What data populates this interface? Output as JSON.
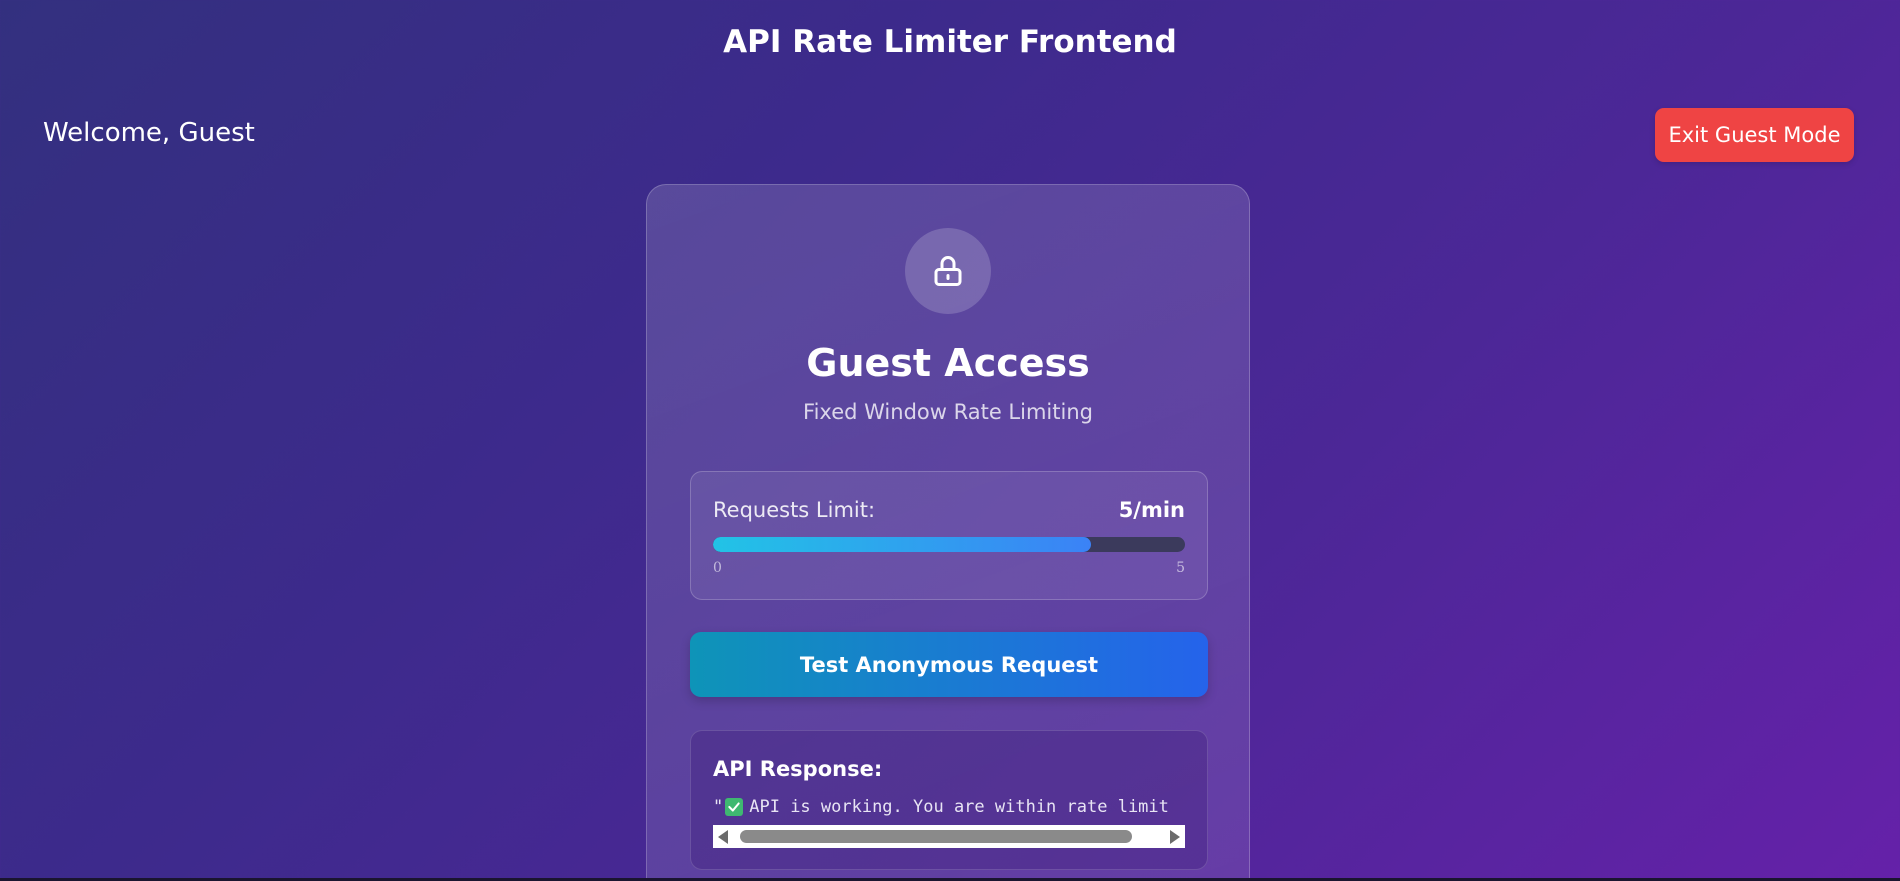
{
  "app": {
    "title": "API Rate Limiter Frontend"
  },
  "header": {
    "welcome_text": "Welcome, Guest",
    "exit_button_label": "Exit Guest Mode"
  },
  "card": {
    "icon": "lock-icon",
    "title": "Guest Access",
    "subtitle": "Fixed Window Rate Limiting",
    "limit": {
      "label": "Requests Limit:",
      "value_text": "5/min",
      "scale_min": "0",
      "scale_max": "5",
      "progress_fraction": 0.8
    },
    "test_button_label": "Test Anonymous Request",
    "response": {
      "title": "API Response:",
      "quote": "\"",
      "icon": "check-icon",
      "text": "API is working. You are within rate limit"
    }
  },
  "colors": {
    "exit_button": "#ef4444",
    "progress_start": "#22c3e6",
    "progress_end": "#3b82f6",
    "test_button_start": "#0e94b8",
    "test_button_end": "#2563eb",
    "check": "#3fb871"
  }
}
